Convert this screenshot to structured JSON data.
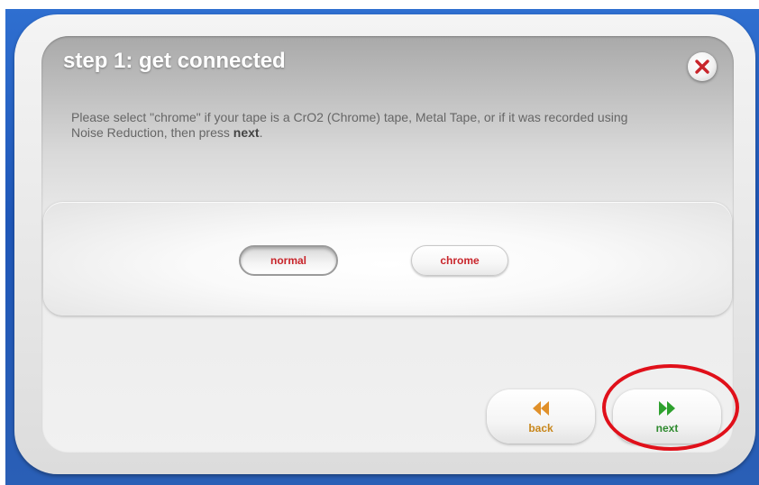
{
  "dialog": {
    "title": "step 1: get connected",
    "instructions": {
      "text": "Please select \"chrome\" if your tape is a CrO2 (Chrome) tape, Metal Tape, or if it was recorded using Noise Reduction, then press ",
      "emphasis": "next",
      "suffix": "."
    }
  },
  "options": [
    {
      "label": "normal",
      "selected": true
    },
    {
      "label": "chrome",
      "selected": false
    }
  ],
  "navigation": {
    "back_label": "back",
    "next_label": "next",
    "back_icon": "rewind-icon",
    "next_icon": "fast-forward-icon"
  },
  "colors": {
    "background": "#2a62bf",
    "option_text": "#c8252b",
    "back_accent": "#e0902a",
    "next_accent": "#2ea12e",
    "highlight": "#e0101a",
    "close_x": "#c8252b"
  }
}
